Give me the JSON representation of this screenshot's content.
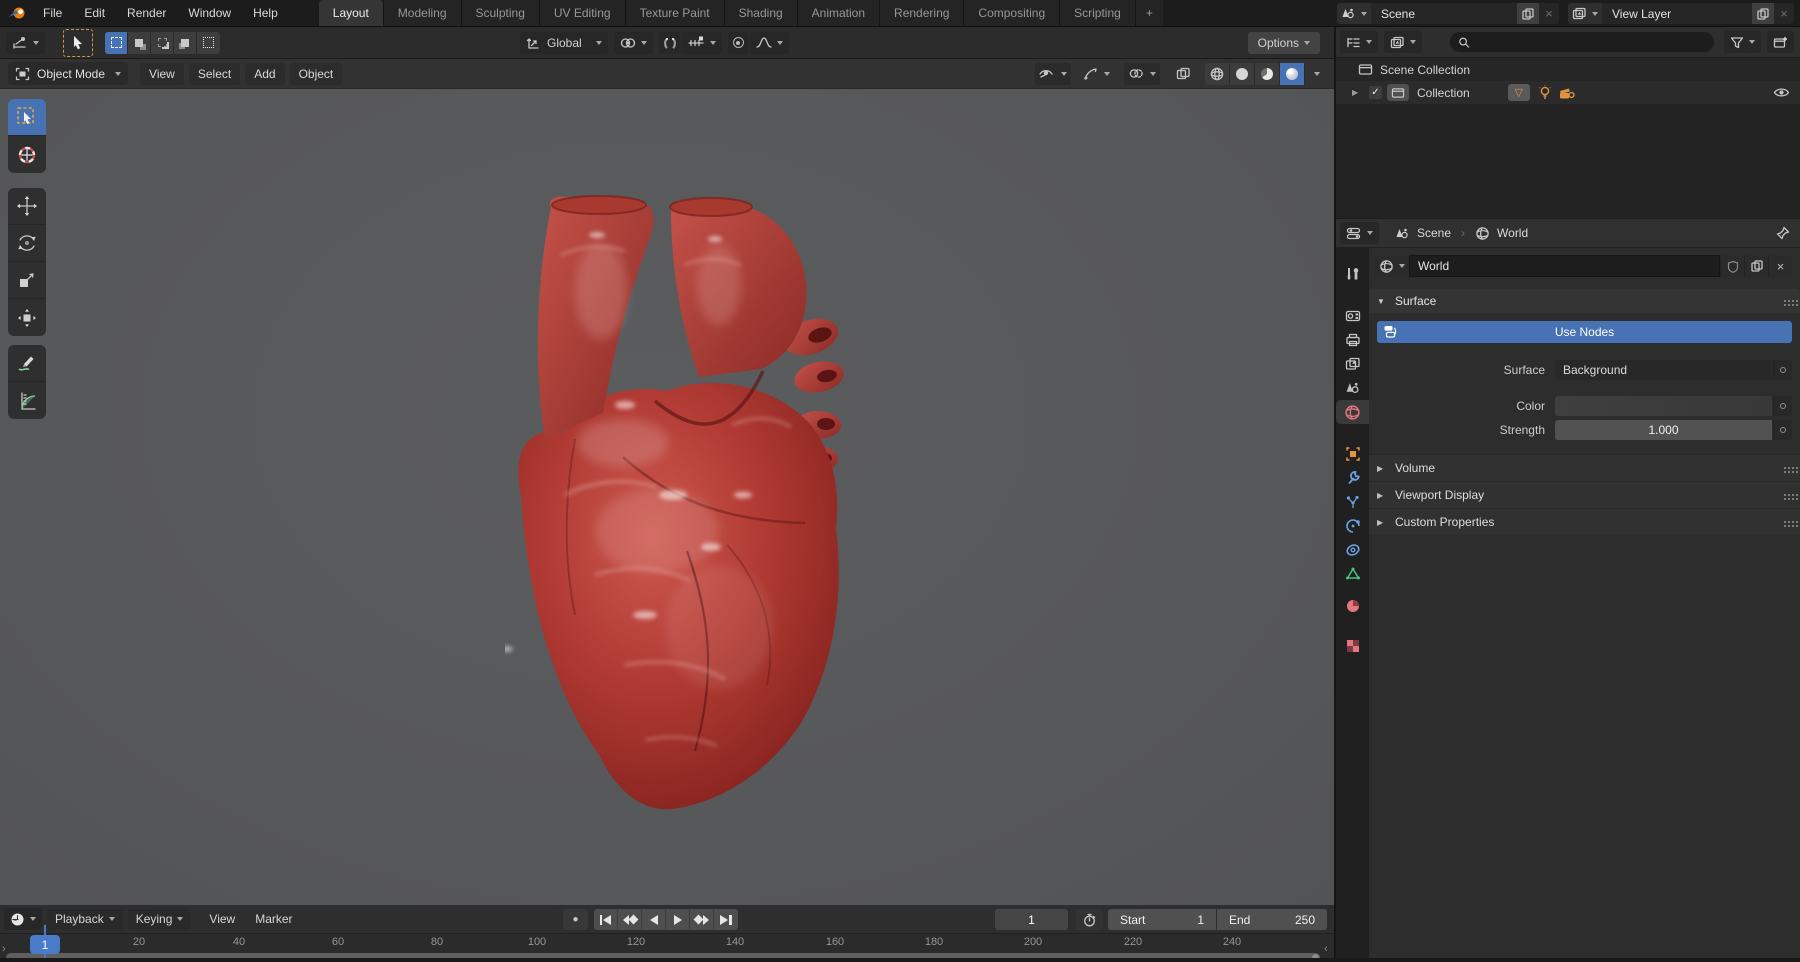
{
  "topbar": {
    "menus": [
      "File",
      "Edit",
      "Render",
      "Window",
      "Help"
    ],
    "workspaces": [
      "Layout",
      "Modeling",
      "Sculpting",
      "UV Editing",
      "Texture Paint",
      "Shading",
      "Animation",
      "Rendering",
      "Compositing",
      "Scripting"
    ],
    "active_workspace": "Layout",
    "new_workspace": "+",
    "scene": {
      "label": "Scene"
    },
    "view_layer": {
      "label": "View Layer"
    }
  },
  "tool_settings": {
    "orientation": {
      "label": "Global"
    },
    "options": {
      "label": "Options"
    }
  },
  "viewport": {
    "mode": {
      "label": "Object Mode"
    },
    "menus": [
      "View",
      "Select",
      "Add",
      "Object"
    ]
  },
  "outliner": {
    "search": {
      "placeholder": ""
    },
    "scene_collection": {
      "label": "Scene Collection"
    },
    "collection": {
      "label": "Collection"
    }
  },
  "properties": {
    "path": {
      "scene": "Scene",
      "world": "World"
    },
    "world_block": {
      "name": "World"
    },
    "surface": {
      "title": "Surface",
      "use_nodes": "Use Nodes",
      "surface_label": "Surface",
      "surface_value": "Background",
      "color_label": "Color",
      "strength_label": "Strength",
      "strength_value": "1.000"
    },
    "panels": {
      "volume": "Volume",
      "viewport_display": "Viewport Display",
      "custom_properties": "Custom Properties"
    }
  },
  "timeline": {
    "menus": {
      "playback": "Playback",
      "keying": "Keying",
      "view": "View",
      "marker": "Marker"
    },
    "current_frame": "1",
    "start": {
      "label": "Start",
      "value": "1"
    },
    "end": {
      "label": "End",
      "value": "250"
    },
    "ticks": [
      "20",
      "40",
      "60",
      "80",
      "100",
      "120",
      "140",
      "160",
      "180",
      "200",
      "220",
      "240"
    ]
  },
  "icons": {
    "collapse_open": "▼",
    "collapse_closed": "▶",
    "disclosure": "▶",
    "check": "✓",
    "close": "×",
    "record": "●",
    "mesh_badge": "▽",
    "breadcrumb_sep": "›"
  },
  "colors": {
    "accent_blue": "#4772b3",
    "viewport_background": "#58585a",
    "selection_orange": "#d49a3c",
    "heart_red": "#a93a34"
  }
}
